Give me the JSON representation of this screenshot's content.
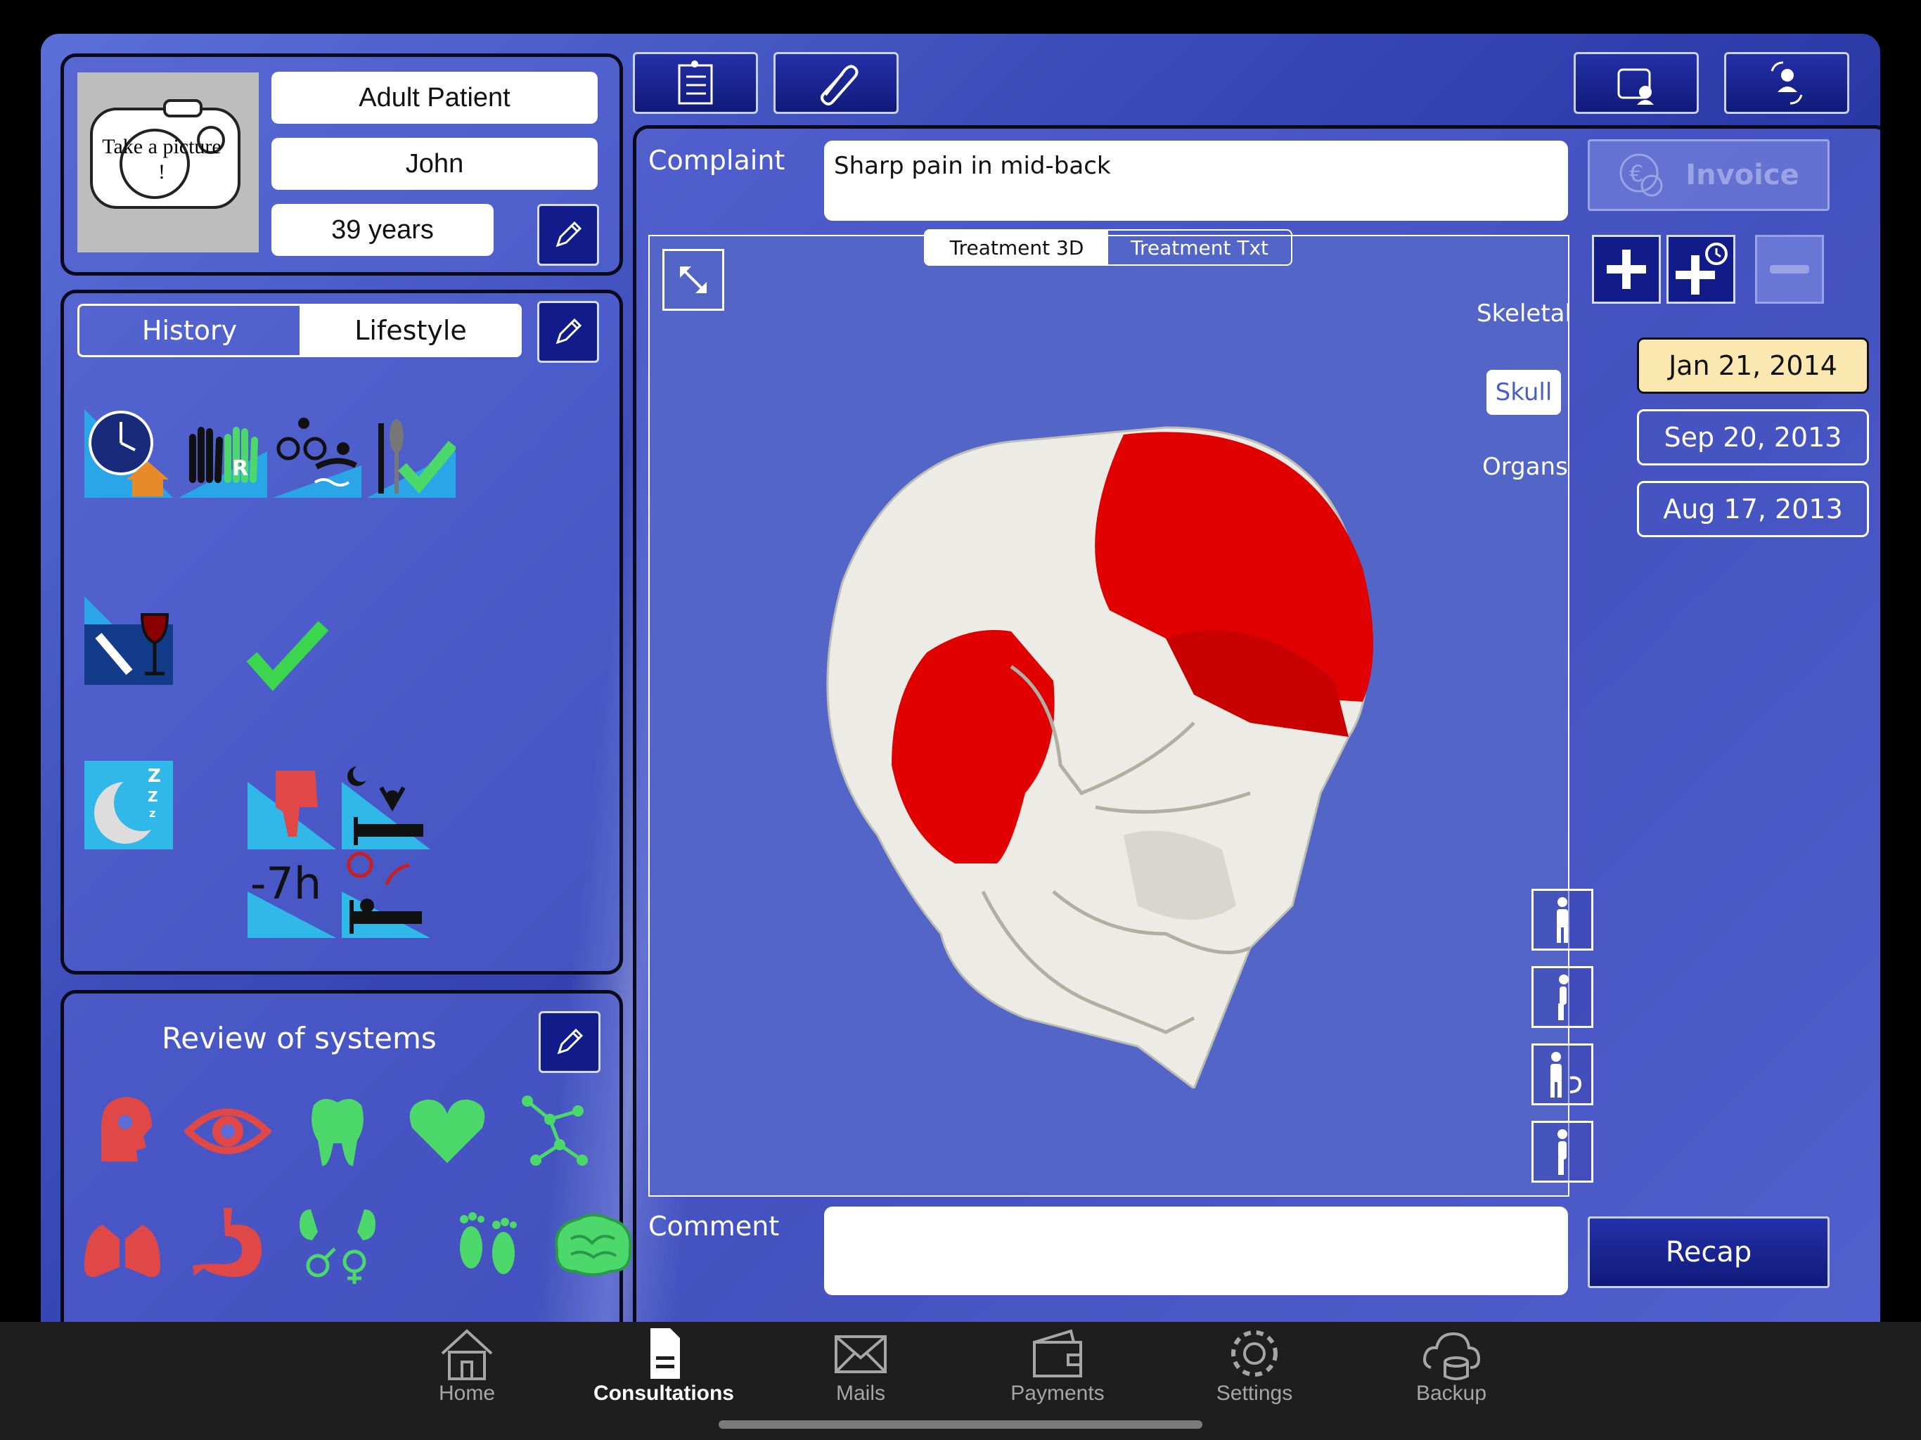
{
  "patient": {
    "photo_label": "Take a picture !",
    "type": "Adult Patient",
    "name": "John",
    "age": "39 years"
  },
  "history_tabs": {
    "history": "History",
    "lifestyle": "Lifestyle"
  },
  "review": {
    "title": "Review of systems"
  },
  "complaint": {
    "label": "Complaint",
    "value": "Sharp pain in mid-back"
  },
  "invoice": {
    "label": "Invoice"
  },
  "treatment_tabs": {
    "t3d": "Treatment 3D",
    "txt": "Treatment Txt"
  },
  "view_options": {
    "skeletal": "Skeletal",
    "skull": "Skull",
    "organs": "Organs"
  },
  "lifestyle_values": {
    "sleep_hours": "-7h"
  },
  "dates": [
    "Jan 21, 2014",
    "Sep 20, 2013",
    "Aug 17, 2013"
  ],
  "comment": {
    "label": "Comment",
    "value": ""
  },
  "recap": {
    "label": "Recap"
  },
  "tabbar": [
    {
      "label": "Home",
      "icon": "home-icon"
    },
    {
      "label": "Consultations",
      "icon": "document-icon"
    },
    {
      "label": "Mails",
      "icon": "mail-icon"
    },
    {
      "label": "Payments",
      "icon": "wallet-icon"
    },
    {
      "label": "Settings",
      "icon": "gear-icon"
    },
    {
      "label": "Backup",
      "icon": "cloud-database-icon"
    }
  ],
  "colors": {
    "accent": "#111c8a",
    "highlight_red": "#e00000",
    "selected_date": "#fbe8b0",
    "green": "#4cd86a",
    "red_icon": "#e04848"
  }
}
